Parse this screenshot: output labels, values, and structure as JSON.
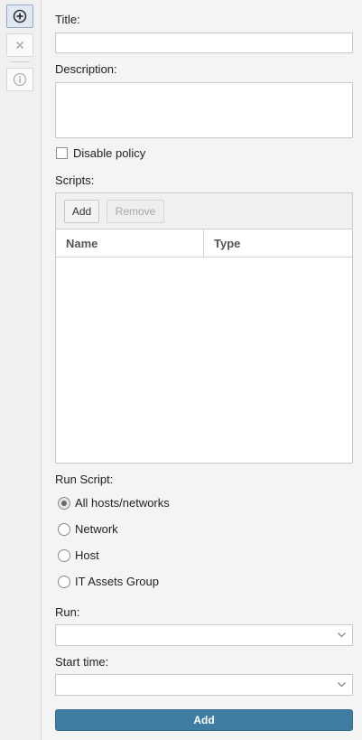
{
  "toolbar": {
    "add_icon": "plus-circle-icon",
    "delete_icon": "close-icon",
    "info_icon": "info-icon"
  },
  "form": {
    "title_label": "Title:",
    "title_value": "",
    "description_label": "Description:",
    "description_value": "",
    "disable_policy_label": "Disable policy",
    "disable_policy_checked": false,
    "scripts_label": "Scripts:",
    "scripts": {
      "add_label": "Add",
      "remove_label": "Remove",
      "columns": [
        "Name",
        "Type"
      ],
      "rows": []
    },
    "run_script_label": "Run Script:",
    "run_script_options": [
      {
        "label": "All hosts/networks",
        "selected": true
      },
      {
        "label": "Network",
        "selected": false
      },
      {
        "label": "Host",
        "selected": false
      },
      {
        "label": "IT Assets Group",
        "selected": false
      }
    ],
    "run_label": "Run:",
    "run_value": "",
    "start_time_label": "Start time:",
    "start_time_value": "",
    "submit_label": "Add"
  },
  "colors": {
    "accent": "#3f7ea2",
    "background": "#f4f4f4"
  }
}
